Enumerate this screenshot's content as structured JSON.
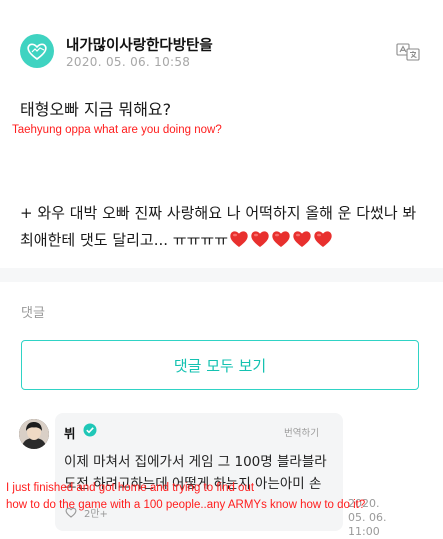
{
  "post": {
    "author_name": "내가많이사랑한다방탄을",
    "date": "2020. 05. 06. 10:58",
    "text_1": "태형오빠 지금 뭐해요?",
    "text_2": "+ 와우 대박 오빠 진짜 사랑해요 나 어떡하지 올해 운 다썼나 봐 최애한테 댓도 달리고... ㅠㅠㅠㅠ",
    "heart_count": 5,
    "heart_color": "#e8302e",
    "logo_color": "#3fd3c1"
  },
  "overlay": {
    "caption_1": "Taehyung oppa what are you doing now?",
    "caption_2_line_1": "I just finished and got home and trying to find out",
    "caption_2_line_2": "how to do the game with a 100 people..any ARMYs know how to do it?",
    "color": "#ff1d1d"
  },
  "comments": {
    "label": "댓글",
    "view_all_label": "댓글 모두 보기",
    "accent_color": "#14c2b1"
  },
  "comment": {
    "author": "뷔",
    "translate_label": "번역하기",
    "text": "이제 마쳐서 집에가서 게임 그 100명 블라블라 도전 하려고하는데 어떻게 하는지 아는아미 손",
    "likes": "2만+",
    "time_line_1": "2020. 05. 06.",
    "time_line_2": "11:00"
  },
  "icons": {
    "logo": "heart-logo-icon",
    "translate": "translate-icon",
    "verified": "verified-check-icon",
    "like": "like-icon"
  }
}
